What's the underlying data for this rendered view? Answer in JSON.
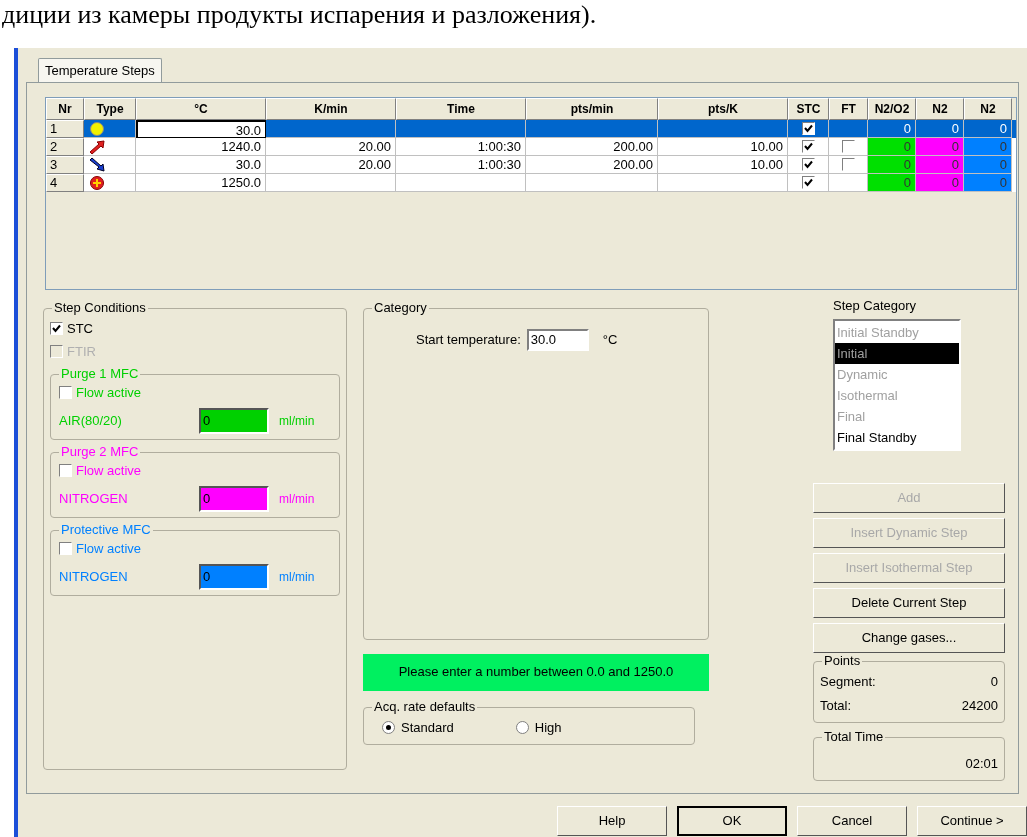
{
  "top_text": "диции из камеры продукты испарения и разложения).",
  "tab": {
    "label": "Temperature Steps",
    "selected": true
  },
  "table": {
    "columns": [
      "Nr",
      "Type",
      "°C",
      "K/min",
      "Time",
      "pts/min",
      "pts/K",
      "STC",
      "FT",
      "N2/O2",
      "N2",
      "N2"
    ],
    "rows": [
      {
        "nr": "1",
        "kind": "initial",
        "celsius": "30.0",
        "k_min": "",
        "time": "",
        "pts_min": "",
        "pts_k": "",
        "stc": true,
        "ft": null,
        "gases": [
          {
            "value": "0",
            "color": "#0066cc"
          },
          {
            "value": "0",
            "color": "#0066cc"
          },
          {
            "value": "0",
            "color": "#0066cc"
          }
        ],
        "selected": true
      },
      {
        "nr": "2",
        "kind": "heating",
        "celsius": "1240.0",
        "k_min": "20.00",
        "time": "1:00:30",
        "pts_min": "200.00",
        "pts_k": "10.00",
        "stc": true,
        "ft": false,
        "gases": [
          {
            "value": "0",
            "color": "#00e000"
          },
          {
            "value": "0",
            "color": "#ff00ff"
          },
          {
            "value": "0",
            "color": "#0080ff"
          }
        ],
        "selected": false
      },
      {
        "nr": "3",
        "kind": "cooling",
        "celsius": "30.0",
        "k_min": "20.00",
        "time": "1:00:30",
        "pts_min": "200.00",
        "pts_k": "10.00",
        "stc": true,
        "ft": false,
        "gases": [
          {
            "value": "0",
            "color": "#00e000"
          },
          {
            "value": "0",
            "color": "#ff00ff"
          },
          {
            "value": "0",
            "color": "#0080ff"
          }
        ],
        "selected": false
      },
      {
        "nr": "4",
        "kind": "final",
        "celsius": "1250.0",
        "k_min": "",
        "time": "",
        "pts_min": "",
        "pts_k": "",
        "stc": true,
        "ft": null,
        "gases": [
          {
            "value": "0",
            "color": "#00e000"
          },
          {
            "value": "0",
            "color": "#ff00ff"
          },
          {
            "value": "0",
            "color": "#0080ff"
          }
        ],
        "selected": false
      }
    ]
  },
  "step_conditions": {
    "title": "Step Conditions",
    "checks": [
      {
        "label": "STC",
        "checked": true,
        "disabled": false
      },
      {
        "label": "FTIR",
        "checked": false,
        "disabled": true
      }
    ],
    "groups": [
      {
        "title": "Purge 1 MFC",
        "color": "#00d000",
        "flow_label": "Flow active",
        "flow_active": false,
        "gas": "AIR(80/20)",
        "value": "0",
        "unit": "ml/min"
      },
      {
        "title": "Purge 2 MFC",
        "color": "#ff00ff",
        "flow_label": "Flow active",
        "flow_active": false,
        "gas": "NITROGEN",
        "value": "0",
        "unit": "ml/min"
      },
      {
        "title": "Protective MFC",
        "color": "#0080ff",
        "flow_label": "Flow active",
        "flow_active": false,
        "gas": "NITROGEN",
        "value": "0",
        "unit": "ml/min"
      }
    ]
  },
  "category": {
    "title": "Category",
    "field_label": "Start temperature:",
    "value": "30.0",
    "unit": "°C"
  },
  "message": "Please enter a number between 0.0 and 1250.0",
  "acq_rate": {
    "title": "Acq. rate defaults",
    "options": [
      {
        "label": "Standard",
        "selected": true
      },
      {
        "label": "High",
        "selected": false
      }
    ]
  },
  "step_category": {
    "title": "Step Category",
    "items": [
      {
        "label": "Initial Standby",
        "selected": false,
        "disabled": true
      },
      {
        "label": "Initial",
        "selected": true,
        "disabled": true
      },
      {
        "label": "Dynamic",
        "selected": false,
        "disabled": true
      },
      {
        "label": "Isothermal",
        "selected": false,
        "disabled": true
      },
      {
        "label": "Final",
        "selected": false,
        "disabled": true
      },
      {
        "label": "Final Standby",
        "selected": false,
        "disabled": false
      }
    ]
  },
  "actions": [
    {
      "label": "Add",
      "disabled": true
    },
    {
      "label": "Insert Dynamic Step",
      "disabled": true
    },
    {
      "label": "Insert Isothermal Step",
      "disabled": true
    },
    {
      "label": "Delete Current Step",
      "disabled": false
    },
    {
      "label": "Change gases...",
      "disabled": false
    }
  ],
  "points": {
    "title": "Points",
    "rows": [
      {
        "label": "Segment:",
        "value": "0"
      },
      {
        "label": "Total:",
        "value": "24200"
      }
    ]
  },
  "total_time": {
    "title": "Total Time",
    "value": "02:01"
  },
  "footer_buttons": [
    {
      "label": "Help",
      "default": false
    },
    {
      "label": "OK",
      "default": true
    },
    {
      "label": "Cancel",
      "default": false
    },
    {
      "label": "Continue >",
      "default": false
    }
  ]
}
